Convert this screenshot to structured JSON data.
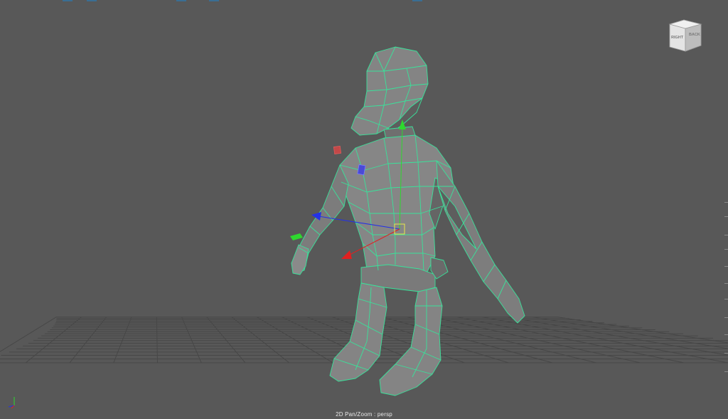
{
  "viewport": {
    "camera_status": "2D Pan/Zoom : persp",
    "viewcube": {
      "front_label": "RIGHT",
      "side_label": "BACK"
    }
  },
  "colors": {
    "background": "#585858",
    "grid": "#444444",
    "wireframe_highlight": "#39e29a",
    "mesh_fill": "#828282",
    "axis_x": "#e02020",
    "axis_y": "#20d020",
    "axis_z": "#2030e0"
  },
  "icons": [
    "viewcube-icon",
    "move-manipulator-icon",
    "origin-axis-icon"
  ]
}
